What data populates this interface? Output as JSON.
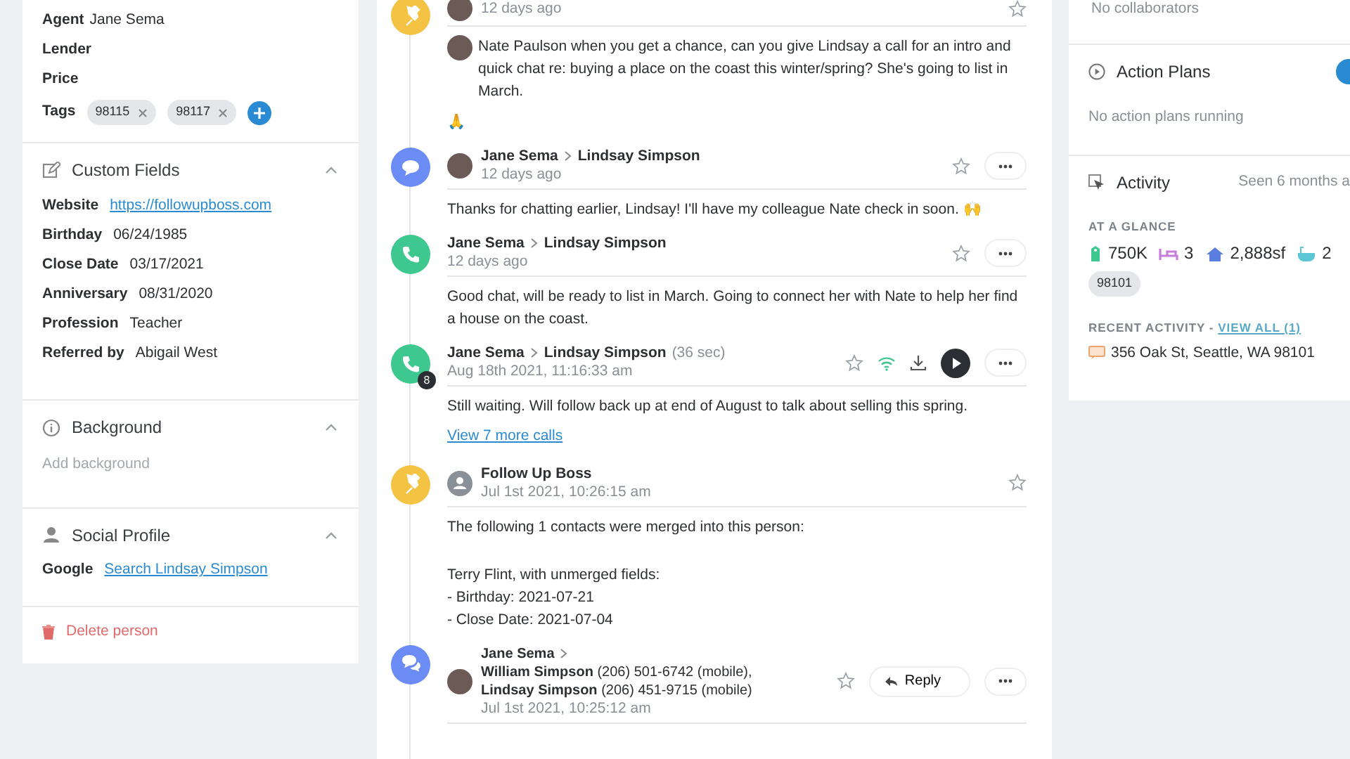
{
  "person_panel": {
    "fields": [
      {
        "label": "Agent",
        "value": "Jane Sema"
      },
      {
        "label": "Lender"
      },
      {
        "label": "Price"
      }
    ],
    "tags": {
      "label": "Tags",
      "items": [
        "98115",
        "98117"
      ]
    },
    "sections": [
      {
        "kind": "custom",
        "title": "Custom Fields",
        "expanded": true,
        "fields": [
          {
            "label": "Website",
            "value": "https://followupboss.com",
            "link": true
          },
          {
            "label": "Birthday",
            "value": "06/24/1985",
            "link": false
          },
          {
            "label": "Close Date",
            "value": "03/17/2021",
            "link": false
          },
          {
            "label": "Anniversary",
            "value": "08/31/2020",
            "link": false
          },
          {
            "label": "Profession",
            "value": "Teacher",
            "link": false
          },
          {
            "label": "Referred by",
            "value": "Abigail West",
            "link": false
          }
        ]
      },
      {
        "kind": "info",
        "title": "Background",
        "expanded": true,
        "placeholder": "Add background"
      },
      {
        "kind": "person",
        "title": "Social Profile",
        "expanded": true,
        "fields": [
          {
            "label": "Google",
            "value": "Search Lindsay Simpson",
            "link": true
          }
        ]
      }
    ],
    "delete": "Delete person"
  },
  "timeline": [
    {
      "kind": "pin",
      "color": "#f5c344",
      "avatar": {
        "kind": "person"
      },
      "time": "12 days ago",
      "actions": [
        {
          "kind": "star"
        }
      ],
      "body": [
        "Nate Paulson when you get a chance, can you give Lindsay a call for an intro and quick chat re: buying a place on the coast this winter/spring? She's going to list in March.",
        "🙏"
      ],
      "mention_avatar": true
    },
    {
      "kind": "chat",
      "color": "#6b8cf5",
      "avatar": {
        "kind": "person"
      },
      "from": "Jane Sema",
      "to": "Lindsay Simpson",
      "time": "12 days ago",
      "actions": [
        {
          "kind": "star"
        },
        {
          "kind": "more"
        }
      ],
      "body": [
        "Thanks for chatting earlier, Lindsay! I'll have my colleague Nate check in soon. 🙌"
      ]
    },
    {
      "kind": "phone",
      "color": "#3ec78f",
      "from": "Jane Sema",
      "to": "Lindsay Simpson",
      "time": "12 days ago",
      "actions": [
        {
          "kind": "star"
        },
        {
          "kind": "more"
        }
      ],
      "body": [
        "Good chat, will be ready to list in March. Going to connect her with Nate to help her find a house on the coast."
      ]
    },
    {
      "kind": "phone",
      "color": "#3ec78f",
      "badge": "8",
      "from": "Jane Sema",
      "to": "Lindsay Simpson",
      "extra": "(36 sec)",
      "time": "Aug 18th 2021, 11:16:33 am",
      "actions": [
        {
          "kind": "star"
        },
        {
          "kind": "signal"
        },
        {
          "kind": "download"
        },
        {
          "kind": "play"
        },
        {
          "kind": "more"
        }
      ],
      "body": [
        "Still waiting. Will follow back up at end of August to talk about selling this spring."
      ],
      "link": "View 7 more calls"
    },
    {
      "kind": "pin",
      "color": "#f5c344",
      "avatar": {
        "kind": "system"
      },
      "from": "Follow Up Boss",
      "time": "Jul 1st 2021, 10:26:15 am",
      "actions": [
        {
          "kind": "star"
        }
      ],
      "body": [
        "The following 1 contacts were merged into this person:",
        "Terry Flint, with unmerged fields:\n- Birthday: 2021-07-21\n- Close Date: 2021-07-04"
      ]
    },
    {
      "kind": "group-chat",
      "color": "#6b8cf5",
      "avatar": {
        "kind": "person"
      },
      "from": "Jane Sema",
      "to": [
        "**William Simpson** (206) 501-6742 (mobile),",
        "**Lindsay Simpson** (206) 451-9715 (mobile)"
      ],
      "time": "Jul 1st 2021, 10:25:12 am",
      "actions": [
        {
          "kind": "star"
        },
        {
          "kind": "reply"
        },
        {
          "kind": "more"
        }
      ],
      "reply": "Reply"
    }
  ],
  "side_panel": {
    "collaborators": "No collaborators",
    "action_plans": {
      "title": "Action Plans",
      "empty": "No action plans running"
    },
    "activity": {
      "title": "Activity",
      "seen": "Seen 6 months a",
      "glance_label": "AT A GLANCE",
      "stats": [
        {
          "kind": "price",
          "value": "750K"
        },
        {
          "kind": "beds",
          "value": "3"
        },
        {
          "kind": "sqft",
          "value": "2,888sf"
        },
        {
          "kind": "baths",
          "value": "2"
        }
      ],
      "chip": "98101",
      "recent_label": "RECENT ACTIVITY - ",
      "recent_link": "VIEW ALL (1)",
      "recent_item": "356 Oak St, Seattle, WA 98101"
    }
  }
}
